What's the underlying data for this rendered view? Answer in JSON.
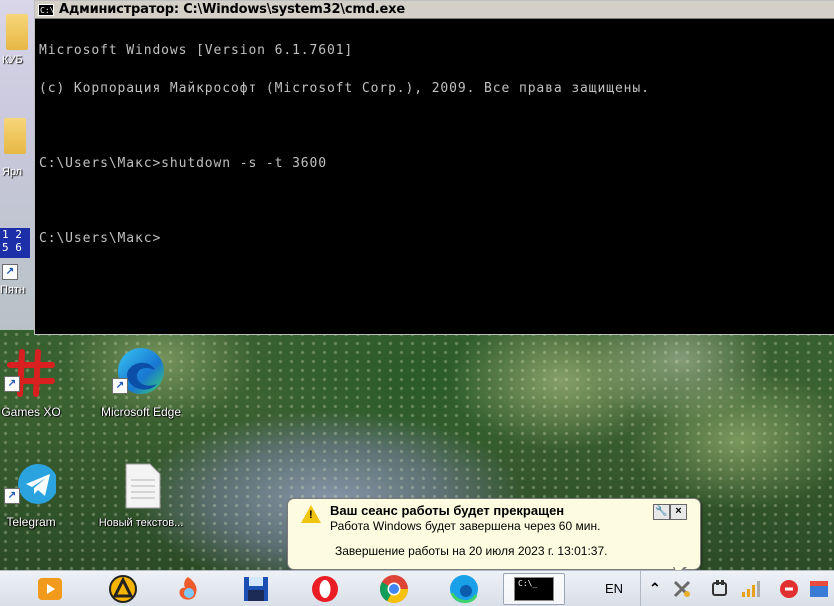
{
  "cmd_window": {
    "title": "Администратор: C:\\Windows\\system32\\cmd.exe",
    "icon_text": "C:\\",
    "lines": [
      "Microsoft Windows [Version 6.1.7601]",
      "(c) Корпорация Майкрософт (Microsoft Corp.), 2009. Все права защищены.",
      "",
      "C:\\Users\\Макс>shutdown -s -t 3600",
      "",
      "C:\\Users\\Макс>"
    ]
  },
  "desktop_icons": {
    "left_labels": [
      "КУБ",
      "Ярл",
      "Пятн"
    ],
    "calendar_digits": [
      "1 2",
      "5 6"
    ],
    "games": "Games XO",
    "edge": "Microsoft Edge",
    "telegram": "Telegram",
    "new_text": "Новый текстов..."
  },
  "balloon": {
    "title": "Ваш сеанс работы будет прекращен",
    "line1": "Работа Windows будет завершена через 60 мин.",
    "line2": "Завершение работы на 20 июля 2023 г. 13:01:37.",
    "options_glyph": "🔧",
    "close_glyph": "×"
  },
  "taskbar": {
    "active_icon_text": "C:\\_",
    "language": "EN",
    "show_hidden_glyph": "⌃"
  },
  "colors": {
    "console_bg": "#000000",
    "console_text": "#c0c0c0",
    "balloon_bg": "#fdfce0",
    "warning": "#f1c40f"
  }
}
